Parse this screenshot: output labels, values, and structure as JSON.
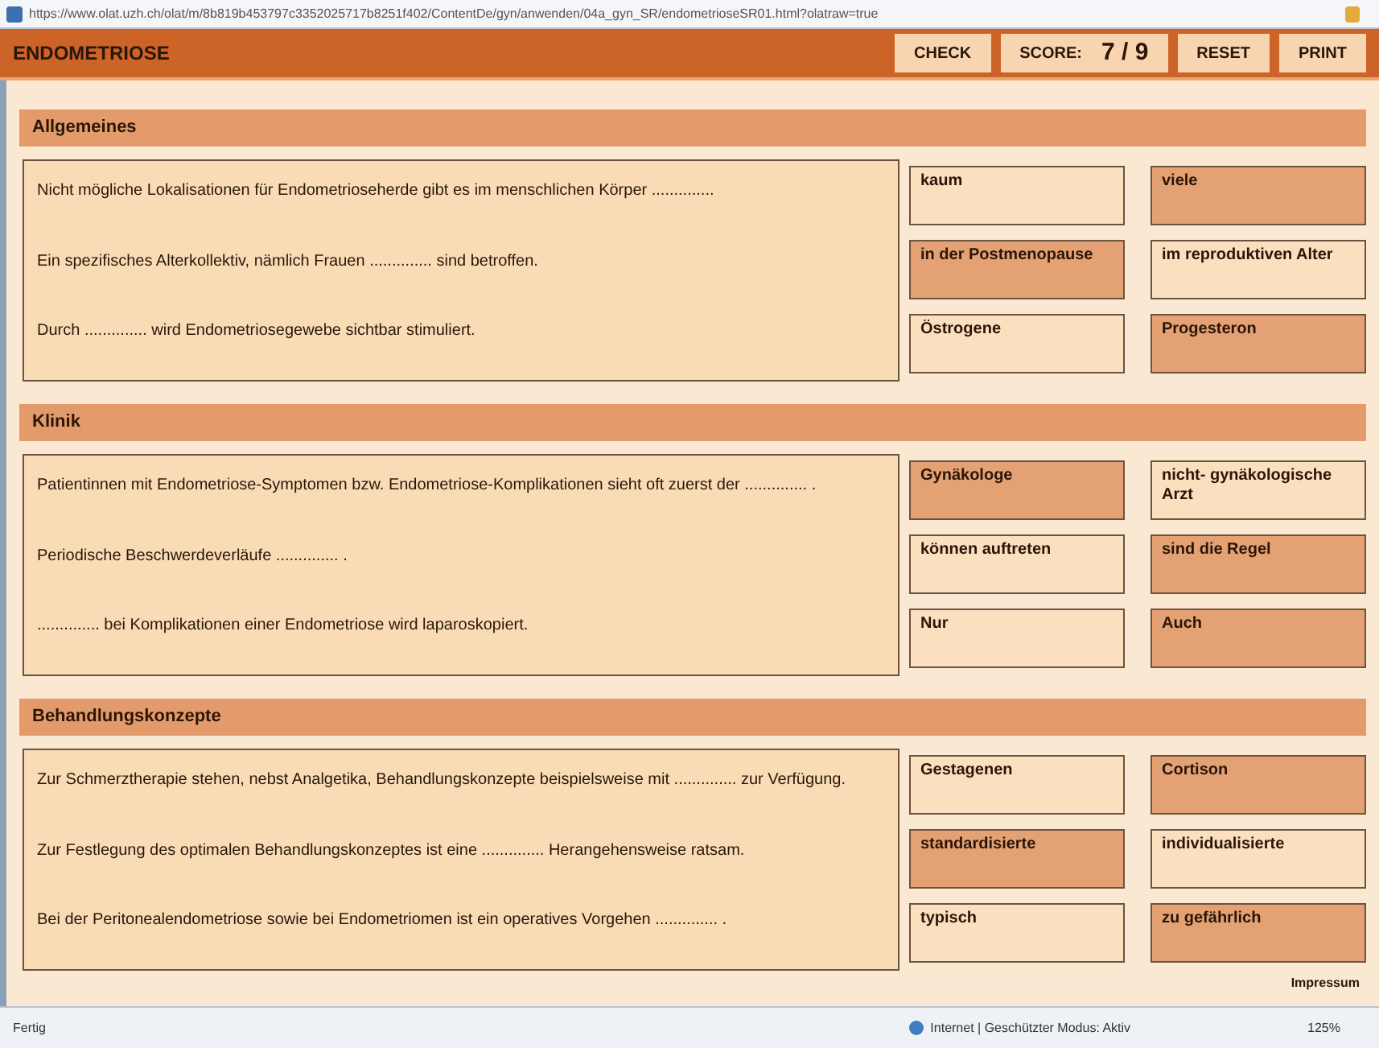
{
  "browser": {
    "url": "https://www.olat.uzh.ch/olat/m/8b819b453797c3352025717b8251f402/ContentDe/gyn/anwenden/04a_gyn_SR/endometrioseSR01.html?olatraw=true"
  },
  "header": {
    "title": "ENDOMETRIOSE",
    "check": "CHECK",
    "score_label": "SCORE:",
    "score_value": "7 / 9",
    "reset": "RESET",
    "print": "PRINT"
  },
  "sections": [
    {
      "title": "Allgemeines",
      "questions": [
        {
          "text": "Nicht mögliche Lokalisationen für Endometrioseherde gibt es  im menschlichen Körper ..............",
          "options": [
            {
              "label": "kaum",
              "selected": false
            },
            {
              "label": "viele",
              "selected": true
            }
          ]
        },
        {
          "text": "Ein spezifisches Alterkollektiv, nämlich Frauen .............. sind betroffen.",
          "options": [
            {
              "label": "in der Postmenopause",
              "selected": true
            },
            {
              "label": "im reproduktiven Alter",
              "selected": false
            }
          ]
        },
        {
          "text": "Durch .............. wird Endometriosegewebe sichtbar stimuliert.",
          "options": [
            {
              "label": "Östrogene",
              "selected": false
            },
            {
              "label": "Progesteron",
              "selected": true
            }
          ]
        }
      ]
    },
    {
      "title": "Klinik",
      "questions": [
        {
          "text": "Patientinnen mit Endometriose-Symptomen bzw. Endometriose-Komplikationen sieht oft zuerst der .............. .",
          "options": [
            {
              "label": "Gynäkologe",
              "selected": true
            },
            {
              "label": "nicht- gynäkologische Arzt",
              "selected": false
            }
          ]
        },
        {
          "text": "Periodische Beschwerdeverläufe .............. .",
          "options": [
            {
              "label": "können auftreten",
              "selected": false
            },
            {
              "label": "sind die Regel",
              "selected": true
            }
          ]
        },
        {
          "text": ".............. bei Komplikationen einer Endometriose wird laparoskopiert.",
          "options": [
            {
              "label": "Nur",
              "selected": false
            },
            {
              "label": "Auch",
              "selected": true
            }
          ]
        }
      ]
    },
    {
      "title": "Behandlungskonzepte",
      "questions": [
        {
          "text": "Zur Schmerztherapie stehen, nebst Analgetika, Behandlungskonzepte beispielsweise mit .............. zur Verfügung.",
          "options": [
            {
              "label": "Gestagenen",
              "selected": false
            },
            {
              "label": "Cortison",
              "selected": true
            }
          ]
        },
        {
          "text": "Zur Festlegung des optimalen Behandlungskonzeptes ist eine .............. Herangehensweise ratsam.",
          "options": [
            {
              "label": "standardisierte",
              "selected": true
            },
            {
              "label": "individualisierte",
              "selected": false
            }
          ]
        },
        {
          "text": "Bei der Peritonealendometriose sowie bei Endometriomen ist ein operatives Vorgehen .............. .",
          "options": [
            {
              "label": "typisch",
              "selected": false
            },
            {
              "label": "zu gefährlich",
              "selected": true
            }
          ]
        }
      ]
    }
  ],
  "footer_link": "Impressum",
  "status_bar": {
    "status": "Fertig",
    "zone": "Internet | Geschützter Modus: Aktiv",
    "zoom": "125%"
  }
}
